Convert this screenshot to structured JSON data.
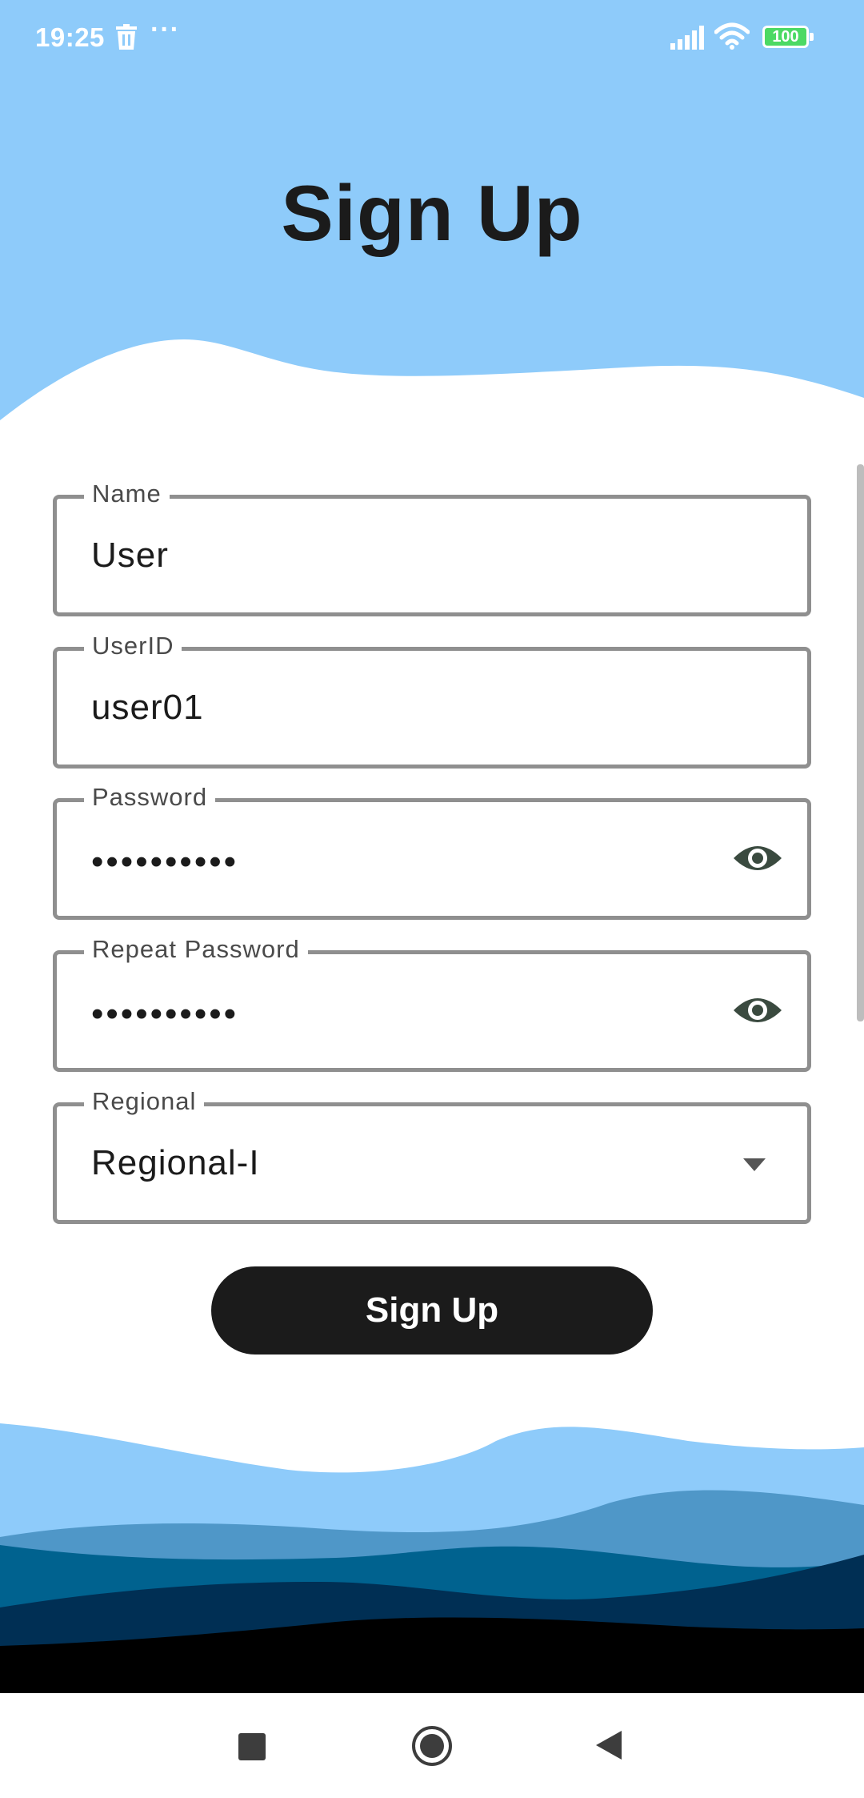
{
  "status_bar": {
    "time": "19:25",
    "dots": "···",
    "battery": "100",
    "icons": [
      "trash-icon",
      "signal-icon",
      "wifi-icon",
      "battery-icon"
    ]
  },
  "header": {
    "title": "Sign Up",
    "background_color": "#8ecbfa"
  },
  "form": {
    "name": {
      "label": "Name",
      "value": "User"
    },
    "userid": {
      "label": "UserID",
      "value": "user01"
    },
    "password": {
      "label": "Password",
      "value": "••••••••••",
      "toggle_icon": "eye-icon"
    },
    "repeat_password": {
      "label": "Repeat Password",
      "value": "••••••••••",
      "toggle_icon": "eye-icon"
    },
    "regional": {
      "label": "Regional",
      "value": "Regional-I",
      "icon": "dropdown-arrow-icon"
    }
  },
  "button": {
    "label": "Sign Up",
    "color": "#1b1b1b"
  },
  "waves": {
    "colors": [
      "#8ecbfa",
      "#4f97c8",
      "#00628f",
      "#002f54",
      "#000000"
    ]
  },
  "nav_bar": {
    "icons": [
      "recents-square-icon",
      "home-circle-icon",
      "back-triangle-icon"
    ]
  }
}
